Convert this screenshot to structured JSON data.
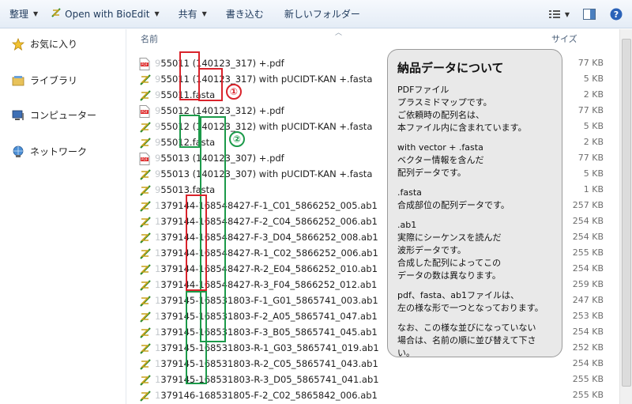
{
  "toolbar": {
    "organize": "整理",
    "open_with": "Open with BioEdit",
    "share": "共有",
    "burn": "書き込む",
    "new_folder": "新しいフォルダー"
  },
  "nav": {
    "favorites": "お気に入り",
    "libraries": "ライブラリ",
    "computer": "コンピューター",
    "network": "ネットワーク"
  },
  "columns": {
    "name": "名前",
    "size": "サイズ"
  },
  "files": [
    {
      "type": "pdf",
      "prefix": "9",
      "name": "55011 (140123_317) +.pdf",
      "size": "77 KB"
    },
    {
      "type": "fasta",
      "prefix": "9",
      "name": "55011 (140123_317) with pUCIDT-KAN +.fasta",
      "size": "5 KB"
    },
    {
      "type": "fasta",
      "prefix": "9",
      "name": "55011.fasta",
      "size": "2 KB"
    },
    {
      "type": "pdf",
      "prefix": "9",
      "name": "55012 (140123_312) +.pdf",
      "size": "77 KB"
    },
    {
      "type": "fasta",
      "prefix": "9",
      "name": "55012 (140123_312) with pUCIDT-KAN +.fasta",
      "size": "5 KB"
    },
    {
      "type": "fasta",
      "prefix": "9",
      "name": "55012.fasta",
      "size": "2 KB"
    },
    {
      "type": "pdf",
      "prefix": "9",
      "name": "55013 (140123_307) +.pdf",
      "size": "77 KB"
    },
    {
      "type": "fasta",
      "prefix": "9",
      "name": "55013 (140123_307) with pUCIDT-KAN +.fasta",
      "size": "5 KB"
    },
    {
      "type": "fasta",
      "prefix": "9",
      "name": "55013.fasta",
      "size": "1 KB"
    },
    {
      "type": "ab1",
      "prefix": "1",
      "name": "379144-168548427-F-1_C01_5866252_005.ab1",
      "size": "257 KB"
    },
    {
      "type": "ab1",
      "prefix": "1",
      "name": "379144-168548427-F-2_C04_5866252_006.ab1",
      "size": "254 KB"
    },
    {
      "type": "ab1",
      "prefix": "1",
      "name": "379144-168548427-F-3_D04_5866252_008.ab1",
      "size": "254 KB"
    },
    {
      "type": "ab1",
      "prefix": "1",
      "name": "379144-168548427-R-1_C02_5866252_006.ab1",
      "size": "255 KB"
    },
    {
      "type": "ab1",
      "prefix": "1",
      "name": "379144-168548427-R-2_E04_5866252_010.ab1",
      "size": "254 KB"
    },
    {
      "type": "ab1",
      "prefix": "1",
      "name": "379144-168548427-R-3_F04_5866252_012.ab1",
      "size": "259 KB"
    },
    {
      "type": "ab1",
      "prefix": "1",
      "name": "379145-168531803-F-1_G01_5865741_003.ab1",
      "size": "247 KB"
    },
    {
      "type": "ab1",
      "prefix": "1",
      "name": "379145-168531803-F-2_A05_5865741_047.ab1",
      "size": "253 KB"
    },
    {
      "type": "ab1",
      "prefix": "1",
      "name": "379145-168531803-F-3_B05_5865741_045.ab1",
      "size": "254 KB"
    },
    {
      "type": "ab1",
      "prefix": "1",
      "name": "379145-168531803-R-1_G03_5865741_019.ab1",
      "size": "252 KB"
    },
    {
      "type": "ab1",
      "prefix": "1",
      "name": "379145-168531803-R-2_C05_5865741_043.ab1",
      "size": "254 KB"
    },
    {
      "type": "ab1",
      "prefix": "1",
      "name": "379145-168531803-R-3_D05_5865741_041.ab1",
      "size": "255 KB"
    },
    {
      "type": "ab1",
      "prefix": "1",
      "name": "379146-168531805-F-2_C02_5865842_006.ab1",
      "size": "255 KB"
    }
  ],
  "annotations": {
    "marker1": "①",
    "marker2": "②"
  },
  "info_panel": {
    "title": "納品データについて",
    "p1": "PDFファイル\nプラスミドマップです。\nご依頼時の配列名は、\n本ファイル内に含まれています。",
    "p2": "with vector + .fasta\nベクター情報を含んだ\n配列データです。",
    "p3": ".fasta\n合成部位の配列データです。",
    "p4": ".ab1\n実際にシーケンスを読んだ\n波形データです。\n合成した配列によってこの\nデータの数は異なります。",
    "p5": "pdf、fasta、ab1ファイルは、\n左の様な形で一つとなっております。",
    "p6": "なお、この様な並びになっていない\n場合は、名前の順に並び替えて下さい。"
  },
  "colors": {
    "red_box": "#d9232b",
    "green_box": "#1c9a4a",
    "toolbar": "#e4ecf6"
  }
}
